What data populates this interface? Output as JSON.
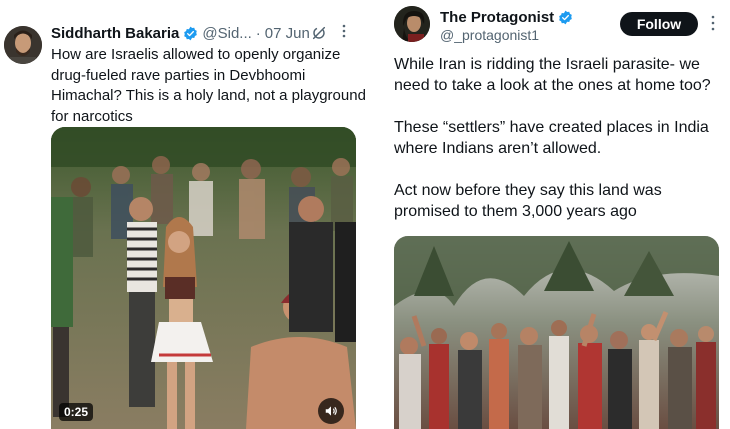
{
  "left_tweet": {
    "author_name": "Siddharth Bakaria",
    "handle": "@Sid...",
    "separator": "·",
    "date": "07 Jun",
    "text": "How are Israelis allowed to openly organize drug-fueled rave parties in Devbhoomi Himachal? This is a holy land, not a playground for narcotics",
    "video_duration": "0:25",
    "icons": [
      "verified-badge-icon",
      "grok-icon",
      "more-options-icon",
      "volume-icon"
    ]
  },
  "right_tweet": {
    "author_name": "The Protagonist",
    "handle": "@_protagonist1",
    "follow_label": "Follow",
    "paragraphs": [
      "While Iran is ridding the Israeli parasite-  we need to take a look at the ones at home too?",
      "These “settlers” have created places in India where Indians aren’t allowed.",
      "Act now before they say this land was promised to them 3,000 years ago"
    ],
    "icons": [
      "verified-badge-icon",
      "more-options-icon"
    ]
  },
  "colors": {
    "text_primary": "#0f1419",
    "text_secondary": "#536471",
    "verified_blue": "#1d9bf0",
    "follow_button_bg": "#0f1419",
    "follow_button_text": "#ffffff"
  }
}
